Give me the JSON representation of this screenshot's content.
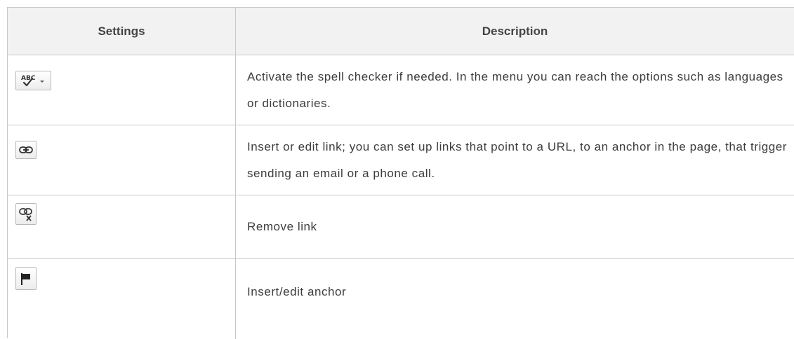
{
  "table": {
    "headers": {
      "settings": "Settings",
      "description": "Description"
    },
    "rows": [
      {
        "icon": "spellcheck-dropdown-icon",
        "description": "Activate the spell checker if needed. In the menu you can reach the options such as languages or dictionaries."
      },
      {
        "icon": "link-icon",
        "description": "Insert or edit link; you can set up links that point to a URL, to an anchor in the page, that trigger sending an email or a phone call."
      },
      {
        "icon": "unlink-icon",
        "description": "Remove link"
      },
      {
        "icon": "anchor-flag-icon",
        "description": "Insert/edit anchor"
      }
    ]
  },
  "icons": {
    "spellcheck_text": "ABC"
  },
  "colors": {
    "border": "#c8c8c8",
    "header_bg": "#f2f2f2",
    "text": "#3c3c3c"
  }
}
